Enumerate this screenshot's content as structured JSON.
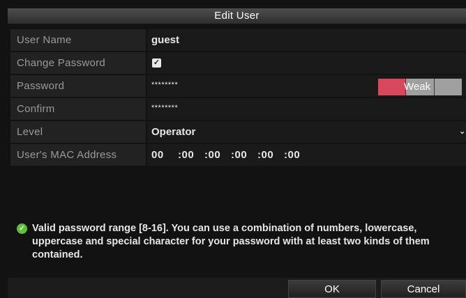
{
  "dialog": {
    "title": "Edit User"
  },
  "fields": {
    "user_name": {
      "label": "User Name",
      "value": "guest"
    },
    "change_password": {
      "label": "Change Password",
      "checked": true
    },
    "password": {
      "label": "Password",
      "value": "********",
      "strength_label": "Weak"
    },
    "confirm": {
      "label": "Confirm",
      "value": "********"
    },
    "level": {
      "label": "Level",
      "value": "Operator"
    },
    "mac": {
      "label": "User's MAC Address",
      "octets": [
        "00",
        ":00",
        ":00",
        ":00",
        ":00",
        ":00"
      ]
    }
  },
  "note": {
    "text": "Valid password range [8-16]. You can use a combination of numbers, lowercase, uppercase and special character for your password with at least two kinds of them contained."
  },
  "buttons": {
    "ok": "OK",
    "cancel": "Cancel"
  },
  "colors": {
    "strength_weak": "#d9475c",
    "strength_inactive": "#9f9f9f",
    "valid_icon": "#5fbf3a"
  },
  "icons": {
    "checkbox": "checkmark-icon",
    "dropdown": "chevron-down-icon",
    "note": "check-circle-icon"
  }
}
